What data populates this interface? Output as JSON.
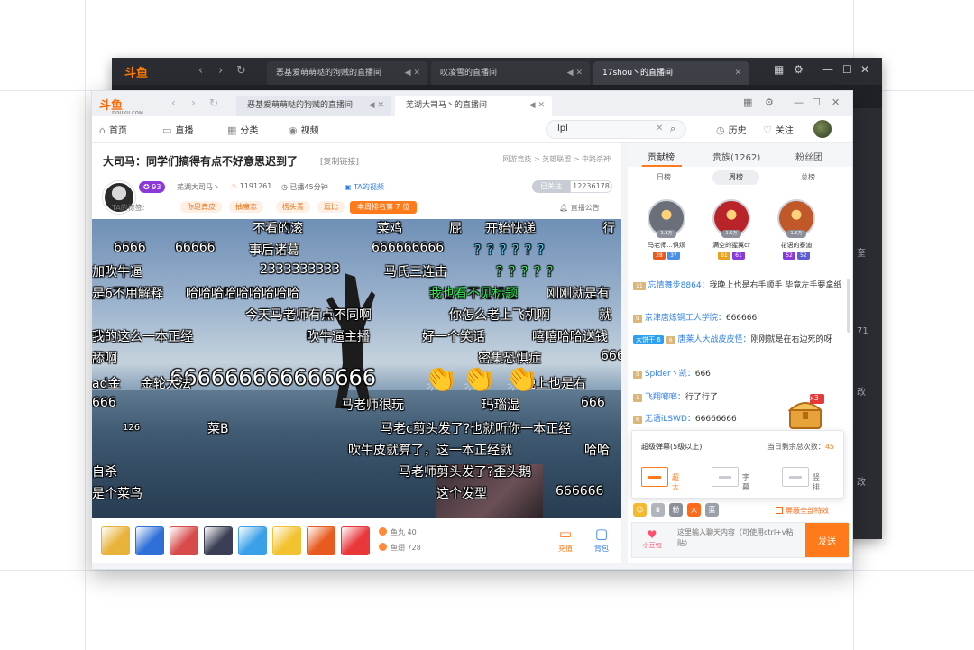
{
  "back_window": {
    "logo": "斗鱼",
    "tabs": [
      {
        "label": "恶基爱萌萌哒的狗贼的直播间"
      },
      {
        "label": "叹凌雪的直播间"
      },
      {
        "label": "17shou丶的直播间"
      }
    ],
    "side_texts": [
      "奎",
      "71",
      "改",
      "改"
    ]
  },
  "front_window": {
    "logo": "斗鱼",
    "logo_sub": "DOUYU.COM",
    "tabs": [
      {
        "label": "恶基爱萌萌哒的狗贼的直播间"
      },
      {
        "label": "芜湖大司马丶的直播间"
      }
    ]
  },
  "nav": {
    "home": "首页",
    "live": "直播",
    "category": "分类",
    "video": "视频",
    "search_value": "lpl",
    "history": "历史",
    "follow": "关注"
  },
  "room": {
    "title": "大司马：同学们搞得有点不好意思迟到了",
    "copy_link": "[复制链接]",
    "breadcrumb": "网游竞技 > 英雄联盟 > 中路杀神",
    "level": "93",
    "streamer": "芜湖大司马丶",
    "heat": "1191261",
    "live_time": "已播45分钟",
    "video_link": "TA的视频",
    "follow_label": "已关注",
    "follow_count": "12236178",
    "tag_label": "TA的标签:",
    "tags": [
      "你是真皮",
      "抽魔恋",
      "楞头青",
      "逗比"
    ],
    "rank": "本周排名第 7 位",
    "announce": "直播公告"
  },
  "danmu": [
    {
      "text": "不看的滚",
      "cls": ""
    },
    {
      "text": "菜鸡",
      "cls": ""
    },
    {
      "text": "屁",
      "cls": ""
    },
    {
      "text": "开始快递",
      "cls": ""
    },
    {
      "text": "行",
      "cls": ""
    },
    {
      "text": "6666",
      "cls": ""
    },
    {
      "text": "66666",
      "cls": ""
    },
    {
      "text": "事后诸葛",
      "cls": ""
    },
    {
      "text": "666666666",
      "cls": ""
    },
    {
      "text": "？？？？？？",
      "cls": "cyan"
    },
    {
      "text": "加吹牛逼",
      "cls": ""
    },
    {
      "text": "2333333333",
      "cls": ""
    },
    {
      "text": "马氏三连击",
      "cls": ""
    },
    {
      "text": "？？？？？",
      "cls": "green"
    },
    {
      "text": "是6不用解释",
      "cls": ""
    },
    {
      "text": "哈哈哈哈哈哈哈哈哈",
      "cls": ""
    },
    {
      "text": "我也看不见标题",
      "cls": "green"
    },
    {
      "text": "刚刚就是有",
      "cls": ""
    },
    {
      "text": "今天马老师有点不同啊",
      "cls": ""
    },
    {
      "text": "你怎么老上飞机啊",
      "cls": ""
    },
    {
      "text": "就",
      "cls": ""
    },
    {
      "text": "我的这么一本正经",
      "cls": ""
    },
    {
      "text": "吹牛逼主播",
      "cls": ""
    },
    {
      "text": "好一个笑话",
      "cls": ""
    },
    {
      "text": "嘻嘻哈哈送钱",
      "cls": ""
    },
    {
      "text": "舔啊",
      "cls": ""
    },
    {
      "text": "密集恐惧症",
      "cls": ""
    },
    {
      "text": "666",
      "cls": ""
    },
    {
      "text": "666666666666666",
      "cls": "big"
    },
    {
      "text": "金轮大法",
      "cls": ""
    },
    {
      "text": "ad金",
      "cls": ""
    },
    {
      "text": "晚上也是右",
      "cls": ""
    },
    {
      "text": "666",
      "cls": ""
    },
    {
      "text": "马老师很玩",
      "cls": ""
    },
    {
      "text": "玛瑙湿",
      "cls": ""
    },
    {
      "text": "666",
      "cls": ""
    },
    {
      "text": "菜B",
      "cls": ""
    },
    {
      "text": "马老c剪头发了?也就听你一本正经",
      "cls": ""
    },
    {
      "text": "吹牛皮就算了，这一本正经就",
      "cls": ""
    },
    {
      "text": "哈哈",
      "cls": ""
    },
    {
      "text": "自杀",
      "cls": ""
    },
    {
      "text": "马老师剪头发了?歪头鹅",
      "cls": ""
    },
    {
      "text": "是个菜鸟",
      "cls": ""
    },
    {
      "text": "这个发型",
      "cls": ""
    },
    {
      "text": "666666",
      "cls": ""
    },
    {
      "text": "126",
      "cls": "small"
    }
  ],
  "gifts": [
    {
      "name": "gift-1",
      "color": "#e8b33a"
    },
    {
      "name": "gift-2",
      "color": "#2f6fd8"
    },
    {
      "name": "gift-3",
      "color": "#d84b4b"
    },
    {
      "name": "gift-4",
      "color": "#3b3f55"
    },
    {
      "name": "gift-5",
      "color": "#3aa0e8"
    },
    {
      "name": "gift-6",
      "color": "#f2c230"
    },
    {
      "name": "gift-7",
      "color": "#e85a1e"
    },
    {
      "name": "gift-8",
      "color": "#e8383a"
    }
  ],
  "wallet": {
    "fish_ball": "鱼丸 40",
    "fish_wing": "鱼翅 728",
    "recharge": "充值",
    "backpack": "背包"
  },
  "ranking": {
    "tabs": [
      "贡献榜",
      "贵族(1262)",
      "粉丝团"
    ],
    "periods": [
      "日榜",
      "周榜",
      "总榜"
    ],
    "top": [
      {
        "name": "马老师...俱烦",
        "score": "1.3万",
        "badges": [
          "28",
          "37"
        ],
        "color": "#6b6f7a"
      },
      {
        "name": "满空的猩翼cr",
        "score": "1.5万",
        "badges": [
          "61",
          "61"
        ],
        "color": "#b8242a"
      },
      {
        "name": "花语的泰迪",
        "score": "1.5万",
        "badges": [
          "52",
          "52"
        ],
        "color": "#c0582a"
      }
    ]
  },
  "chat": [
    {
      "lvl": "11",
      "user": "忘情舞步8864：",
      "msg": "我晚上也是右手顺手 毕竟左手要拿纸",
      "fan": ""
    },
    {
      "lvl": "9",
      "user": "京津唐炼钢工人学院：",
      "msg": "666666",
      "fan": ""
    },
    {
      "lvl": "6",
      "user": "唐莱人大战皮皮怪：",
      "msg": "刚刚就是在右边死的呀",
      "fan": "大饼干 6"
    },
    {
      "lvl": "5",
      "user": "Spider丶凯：",
      "msg": "666",
      "fan": ""
    },
    {
      "lvl": "1",
      "user": "飞翔啷啷：",
      "msg": "行了行了",
      "fan": ""
    },
    {
      "lvl": "6",
      "user": "无语iLSWD：",
      "msg": "66666666",
      "fan": ""
    }
  ],
  "treasure_count": "x3",
  "effects": {
    "title": "超级弹幕(5级以上)",
    "remaining_label": "当日剩余总次数：",
    "remaining_value": "45",
    "options": [
      "超大",
      "字幕",
      "竖排"
    ]
  },
  "chat_tools": {
    "tools": [
      "☺",
      "♛",
      "粉",
      "大",
      "蓝"
    ],
    "block_effects": "屏蔽全部特效"
  },
  "input": {
    "small_bag": "小豆包",
    "placeholder": "这里输入聊天内容（可使用ctrl+v粘贴）",
    "send": "发送"
  }
}
